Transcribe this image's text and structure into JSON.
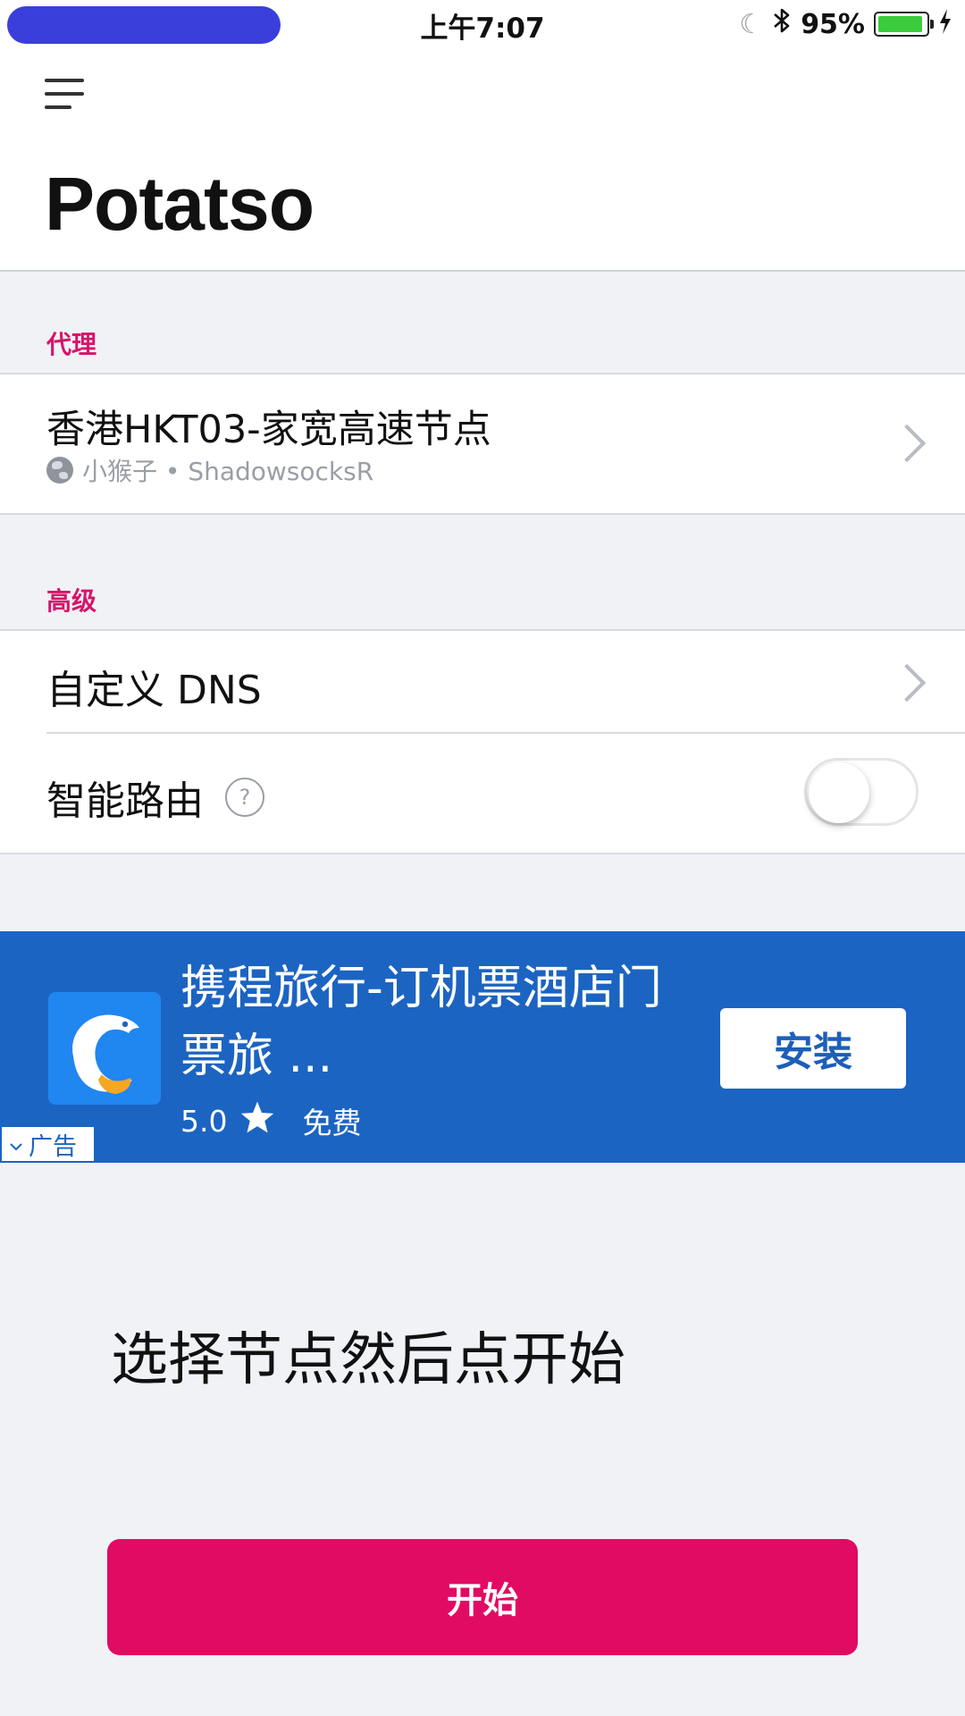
{
  "status_bar": {
    "time": "上午7:07",
    "battery": "95%",
    "battery_level": 0.95,
    "icons": [
      "moon-icon",
      "bluetooth-icon",
      "battery-icon",
      "charging-bolt-icon"
    ]
  },
  "header": {
    "menu_icon": "hamburger-menu-icon",
    "title": "Potatso"
  },
  "proxy_section": {
    "label": "代理",
    "item": {
      "name": "香港HKT03-家宽高速节点",
      "subtitle": "小猴子 • ShadowsocksR",
      "icon": "globe-icon"
    }
  },
  "advanced_section": {
    "label": "高级",
    "custom_dns": "自定义 DNS",
    "smart_routing": "智能路由",
    "help_glyph": "?",
    "smart_routing_enabled": false
  },
  "ad": {
    "title": "携程旅行-订机票酒店门票旅 ...",
    "rating": "5.0",
    "price": "免费",
    "install_label": "安装",
    "tag": "广告",
    "colors": {
      "background": "#1c64c2",
      "logo": "#2086f0"
    }
  },
  "main": {
    "hint": "选择节点然后点开始",
    "start_label": "开始"
  },
  "colors": {
    "accent": "#e10b63",
    "section_label": "#d7146a",
    "background": "#f0f2f6"
  }
}
